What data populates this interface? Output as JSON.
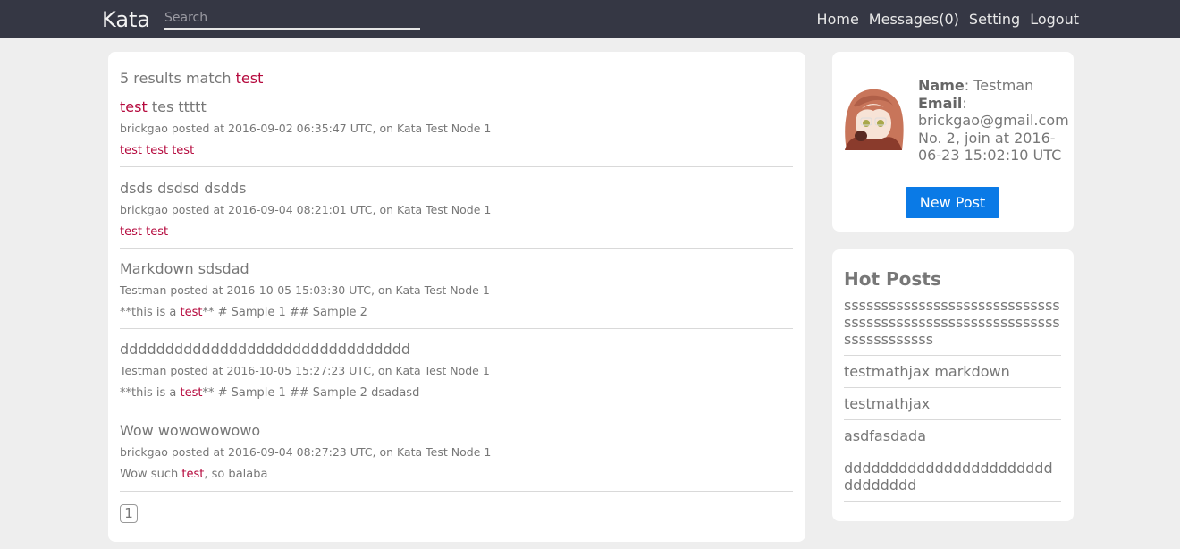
{
  "navbar": {
    "brand": "Kata",
    "search_placeholder": "Search",
    "links": [
      "Home",
      "Messages(0)",
      "Setting",
      "Logout"
    ]
  },
  "search": {
    "count_text": "5 results match ",
    "query": "test"
  },
  "results": [
    {
      "title_parts": [
        {
          "t": "test",
          "hl": true
        },
        {
          "t": " tes ttttt",
          "hl": false
        }
      ],
      "meta": "brickgao posted at 2016-09-02 06:35:47 UTC, on Kata Test Node 1",
      "snippet_parts": [
        {
          "t": "test test test",
          "hl": true
        }
      ]
    },
    {
      "title_parts": [
        {
          "t": "dsds dsdsd dsdds",
          "hl": false
        }
      ],
      "meta": "brickgao posted at 2016-09-04 08:21:01 UTC, on Kata Test Node 1",
      "snippet_parts": [
        {
          "t": "test test",
          "hl": true
        }
      ]
    },
    {
      "title_parts": [
        {
          "t": "Markdown sdsdad",
          "hl": false
        }
      ],
      "meta": "Testman posted at 2016-10-05 15:03:30 UTC, on Kata Test Node 1",
      "snippet_parts": [
        {
          "t": "**this is a ",
          "hl": false
        },
        {
          "t": "test",
          "hl": true
        },
        {
          "t": "** # Sample 1 ## Sample 2",
          "hl": false
        }
      ]
    },
    {
      "title_parts": [
        {
          "t": "dddddddddddddddddddddddddddddddd",
          "hl": false
        }
      ],
      "meta": "Testman posted at 2016-10-05 15:27:23 UTC, on Kata Test Node 1",
      "snippet_parts": [
        {
          "t": "**this is a ",
          "hl": false
        },
        {
          "t": "test",
          "hl": true
        },
        {
          "t": "** # Sample 1 ## Sample 2 dsadasd",
          "hl": false
        }
      ]
    },
    {
      "title_parts": [
        {
          "t": "Wow wowowowowo",
          "hl": false
        }
      ],
      "meta": "brickgao posted at 2016-09-04 08:27:23 UTC, on Kata Test Node 1",
      "snippet_parts": [
        {
          "t": "Wow such ",
          "hl": false
        },
        {
          "t": "test",
          "hl": true
        },
        {
          "t": ", so balaba",
          "hl": false
        }
      ]
    }
  ],
  "pagination": {
    "current": "1"
  },
  "profile": {
    "name_label": "Name",
    "name_value": ": Testman",
    "email_label": "Email",
    "email_value": ":",
    "email": "brickgao@gmail.com",
    "member_info": "No. 2, join at 2016-06-23 15:02:10 UTC",
    "new_post_label": "New Post"
  },
  "hot_posts": {
    "title": "Hot Posts",
    "items": [
      "ssssssssssssssssssssssssssssssssssssssssssssssssssssssssssssssssssssss",
      "testmathjax markdown",
      "testmathjax",
      "asdfasdada",
      "ddddddddddddddddddddddddddddddd"
    ]
  },
  "colors": {
    "navbar_bg": "#353744",
    "highlight": "#b5093d",
    "button_bg": "#0a7ae6",
    "page_bg": "#eeeeee"
  }
}
